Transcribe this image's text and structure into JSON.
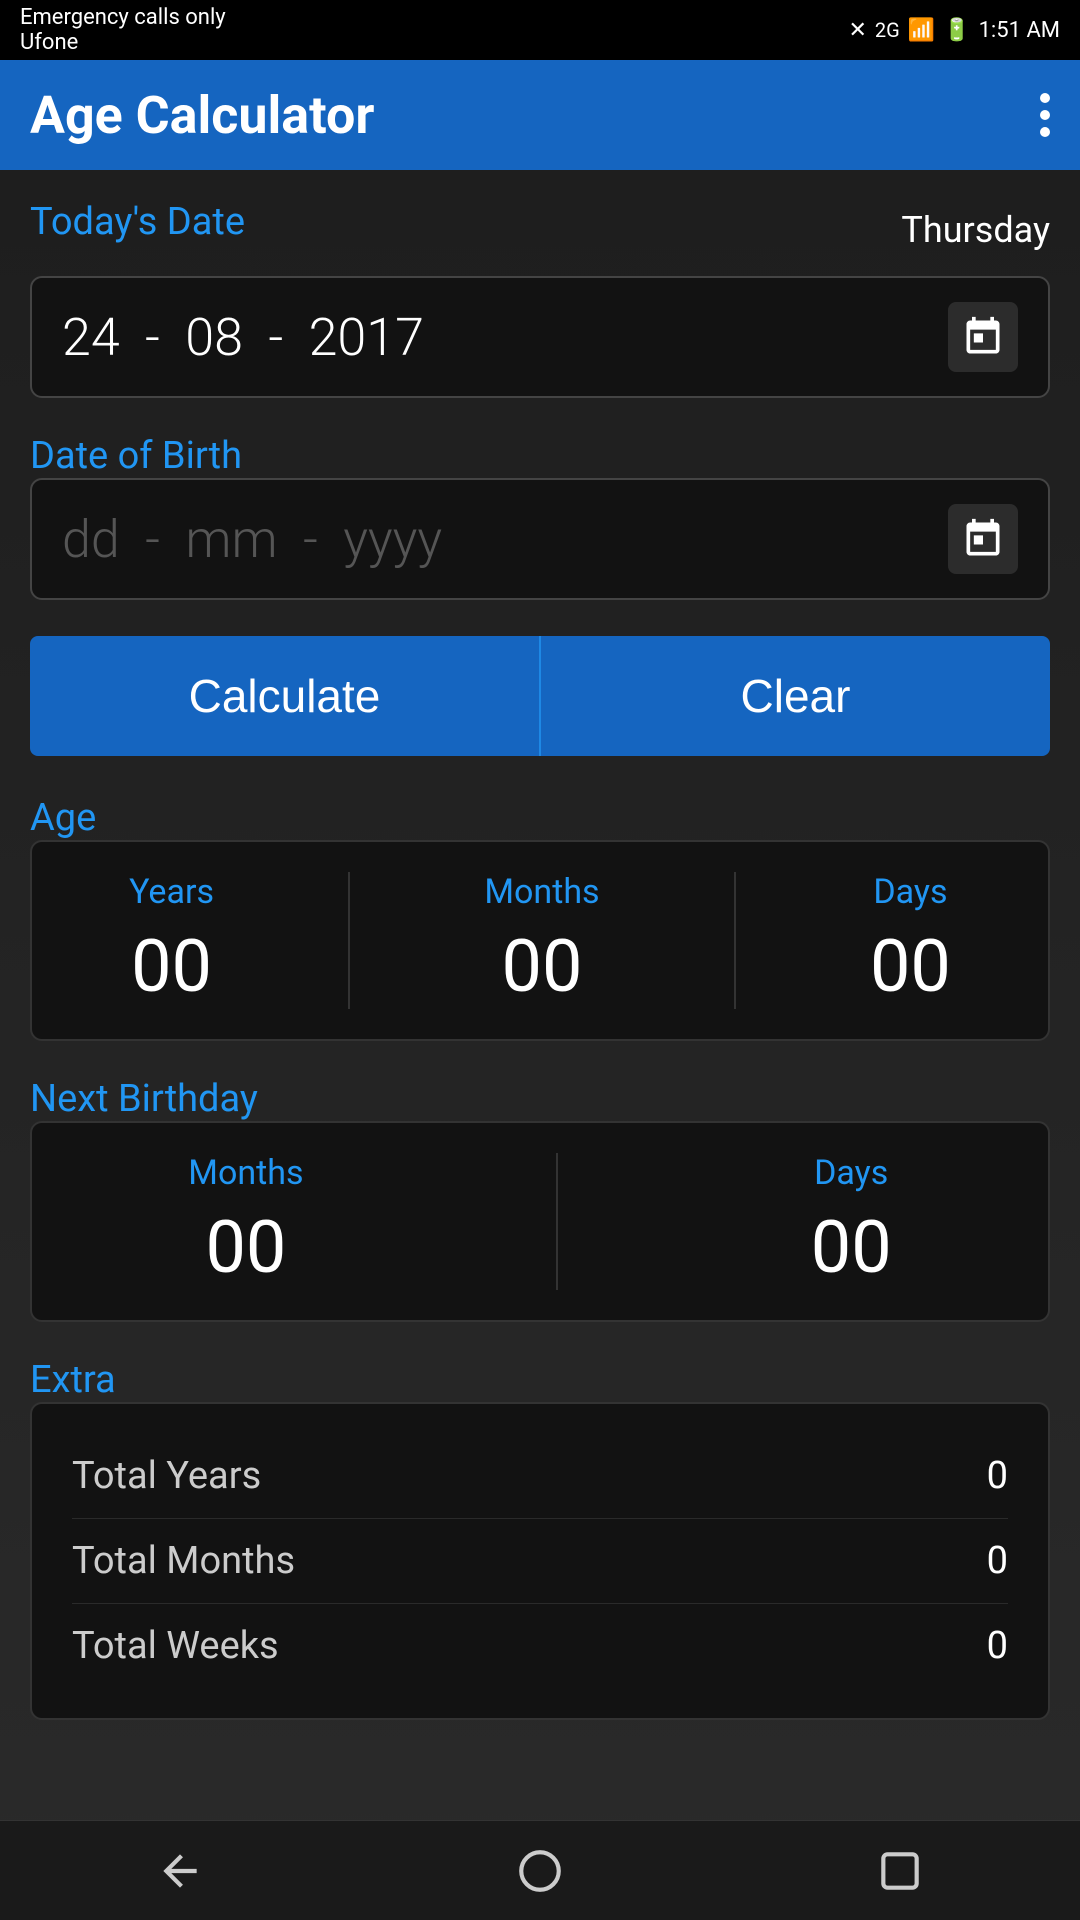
{
  "statusBar": {
    "carrier": "Emergency calls only",
    "network": "Ufone",
    "time": "1:51 AM",
    "signal": "2G"
  },
  "appBar": {
    "title": "Age Calculator",
    "moreMenuLabel": "More options"
  },
  "todaysDate": {
    "sectionLabel": "Today's Date",
    "dayName": "Thursday",
    "day": "24",
    "separator1": "-",
    "month": "08",
    "separator2": "-",
    "year": "2017"
  },
  "dateOfBirth": {
    "sectionLabel": "Date of Birth",
    "placeholder_day": "dd",
    "placeholder_month": "mm",
    "placeholder_year": "yyyy",
    "separator1": "-",
    "separator2": "-"
  },
  "buttons": {
    "calculate": "Calculate",
    "clear": "Clear"
  },
  "age": {
    "sectionLabel": "Age",
    "years_label": "Years",
    "years_value": "00",
    "months_label": "Months",
    "months_value": "00",
    "days_label": "Days",
    "days_value": "00"
  },
  "nextBirthday": {
    "sectionLabel": "Next Birthday",
    "months_label": "Months",
    "months_value": "00",
    "days_label": "Days",
    "days_value": "00"
  },
  "extra": {
    "sectionLabel": "Extra",
    "rows": [
      {
        "label": "Total Years",
        "value": "0"
      },
      {
        "label": "Total Months",
        "value": "0"
      },
      {
        "label": "Total Weeks",
        "value": "0"
      }
    ]
  },
  "navBar": {
    "back": "back",
    "home": "home",
    "recent": "recent"
  }
}
